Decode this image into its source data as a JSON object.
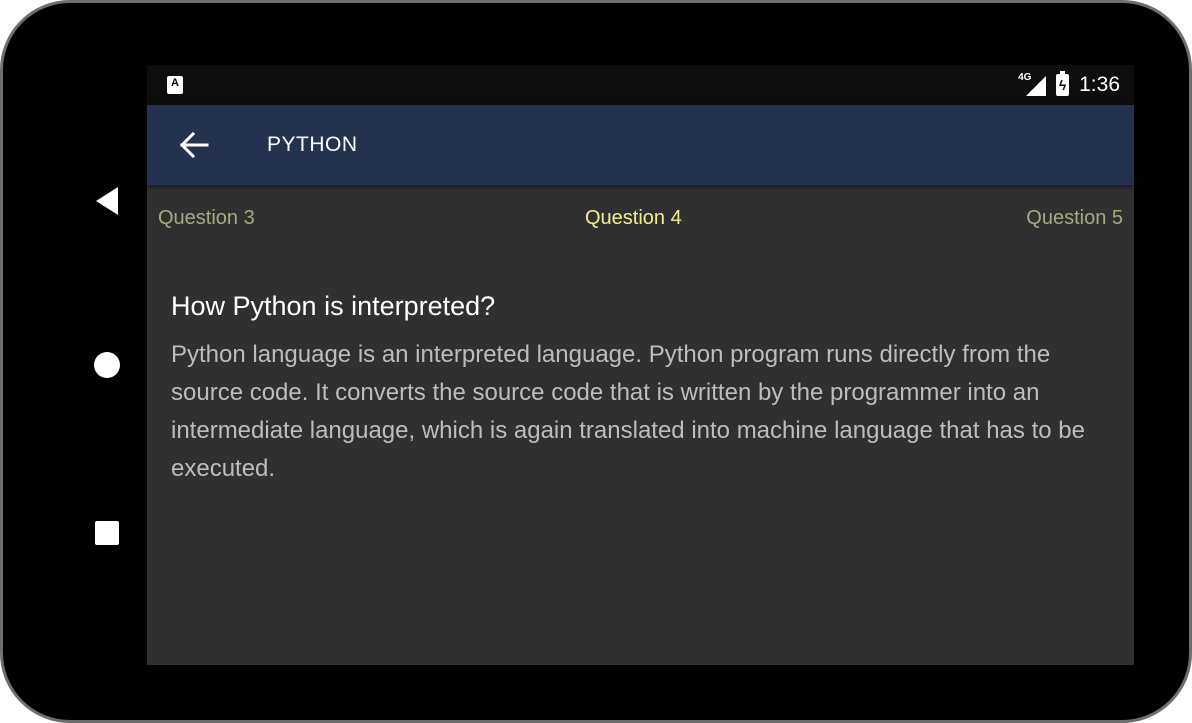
{
  "status_bar": {
    "left_icon": "A",
    "network_label": "4G",
    "time": "1:36"
  },
  "app_bar": {
    "title": "PYTHON",
    "back_icon": "arrow-left-icon"
  },
  "tabs": [
    {
      "label": "Question 3",
      "active": false
    },
    {
      "label": "Question 4",
      "active": true
    },
    {
      "label": "Question 5",
      "active": false
    }
  ],
  "content": {
    "question": "How Python is interpreted?",
    "answer": "Python language is an interpreted language. Python program runs directly from the source code. It converts the source code that is written by the programmer into an intermediate language, which is again translated into machine language that has to be executed."
  },
  "colors": {
    "app_bar": "#24324f",
    "screen_background": "#303030",
    "active_tab": "#f2f08c",
    "inactive_tab": "#a8a882",
    "answer_text": "#bdbdbd"
  }
}
